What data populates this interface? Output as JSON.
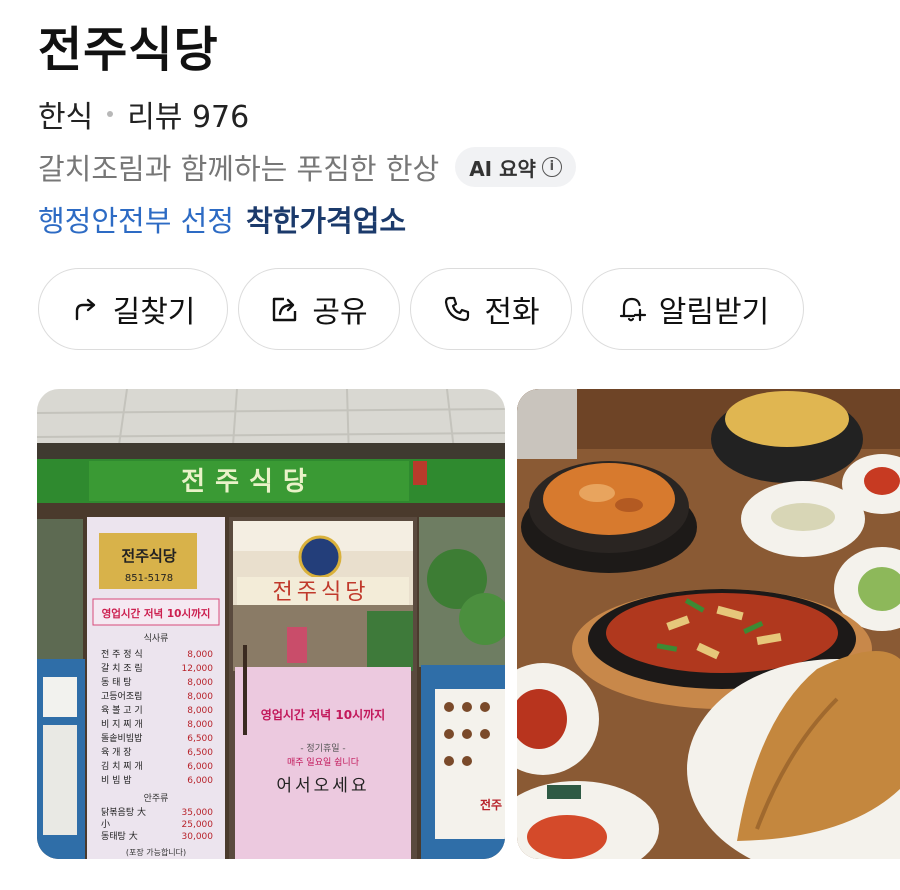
{
  "place": {
    "name": "전주식당",
    "category": "한식",
    "review_label": "리뷰 976",
    "summary": "갈치조림과 함께하는 푸짐한 한상",
    "ai_badge": "AI 요약",
    "ai_info_glyph": "i",
    "cert_prefix": "행정안전부 선정",
    "cert_name": "착한가격업소"
  },
  "actions": [
    {
      "label": "길찾기",
      "icon": "directions-icon"
    },
    {
      "label": "공유",
      "icon": "share-icon"
    },
    {
      "label": "전화",
      "icon": "phone-icon"
    },
    {
      "label": "알림받기",
      "icon": "bell-plus-icon"
    }
  ],
  "photo1": {
    "sign_text": "전주식당",
    "banner_sign": "전주식당",
    "phone": "851-5178",
    "hours": "영업시간 저녁 10시까지",
    "menu_header": "식사류",
    "menu": [
      {
        "name": "전 주 정 식",
        "price": "8,000"
      },
      {
        "name": "갈 치 조 림",
        "price": "12,000"
      },
      {
        "name": "동 태 탕",
        "price": "8,000"
      },
      {
        "name": "고등어조림",
        "price": "8,000"
      },
      {
        "name": "육 볼 고 기",
        "price": "8,000"
      },
      {
        "name": "비 지 찌 개",
        "price": "8,000"
      },
      {
        "name": "돌솥비빔밥",
        "price": "6,500"
      },
      {
        "name": "육 개 장",
        "price": "6,500"
      },
      {
        "name": "김 치 찌 개",
        "price": "6,000"
      },
      {
        "name": "비 빔 밥",
        "price": "6,000"
      }
    ],
    "snack_header": "안주류",
    "snacks": [
      {
        "name": "닭볶음탕 大",
        "price": "35,000"
      },
      {
        "name": "小",
        "price": "25,000"
      },
      {
        "name": "동태탕 大",
        "price": "30,000"
      }
    ],
    "takeout": "(포장 가능합니다)",
    "door_hours": "영업시간 저녁 10시까지",
    "door_holiday": "- 정기휴일 -",
    "door_holiday_detail": "매주 일요일 쉽니다",
    "door_welcome": "어서오세요",
    "right_sign": "전주"
  },
  "colors": {
    "accent_blue": "#2d6bc4",
    "cert_navy": "#1b3a6b",
    "muted": "#777777"
  }
}
